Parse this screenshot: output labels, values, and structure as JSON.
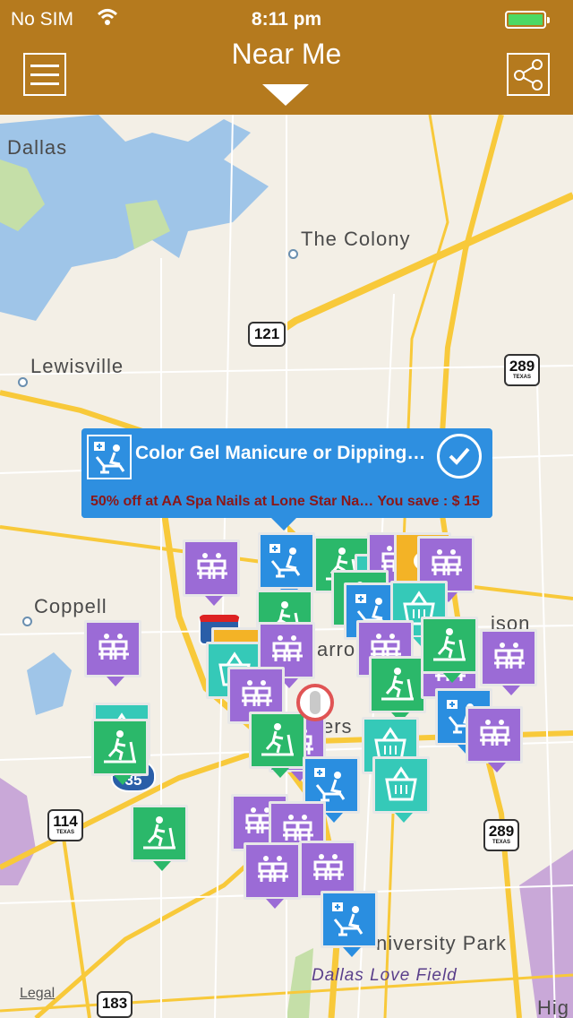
{
  "status_bar": {
    "carrier": "No SIM",
    "time": "8:11 pm",
    "wifi_icon": "wifi-icon",
    "battery_icon": "battery-icon"
  },
  "header": {
    "title": "Near Me",
    "menu_icon": "hamburger-menu-icon",
    "share_icon": "share-icon",
    "background": "#b57a1e"
  },
  "map": {
    "places": [
      "Dallas",
      "The Colony",
      "Lewisville",
      "Coppell",
      "arro",
      "ers",
      "ison",
      "niversity Park",
      "Dallas Love Field",
      "Hig"
    ],
    "highways": [
      {
        "number": "121",
        "state": ""
      },
      {
        "number": "289",
        "state": "TEXAS"
      },
      {
        "number": "114",
        "state": "TEXAS"
      },
      {
        "number": "289",
        "state": "TEXAS"
      },
      {
        "number": "183",
        "state": ""
      },
      {
        "number": "35",
        "state": ""
      }
    ],
    "legal": "Legal",
    "pin_categories": {
      "purple": "salon-chairs-icon",
      "green": "treadmill-icon",
      "blue": "dental-chair-icon",
      "teal": "grocery-basket-icon",
      "yellow": "generic-icon"
    }
  },
  "callout": {
    "title": "Color Gel Manicure or Dipping…",
    "subtitle": "50% off at AA Spa Nails at Lone Star Na… You save : $ 15",
    "category_icon": "dental-chair-icon",
    "check_icon": "checkmark-icon",
    "background": "#2e8fe0",
    "subtitle_color": "#8b1717"
  }
}
